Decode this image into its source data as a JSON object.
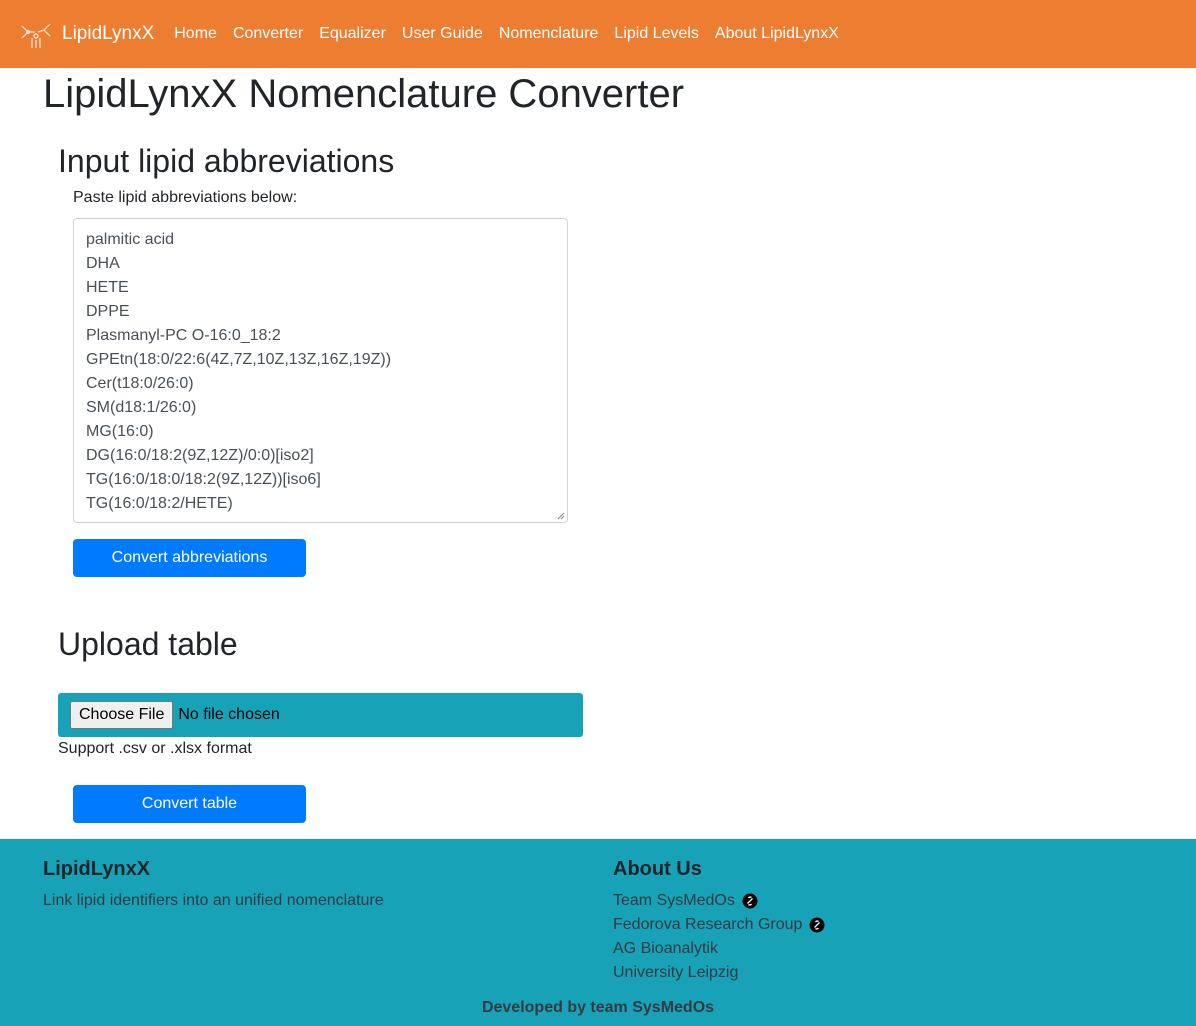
{
  "colors": {
    "nav_bg": "#ed7d31",
    "primary": "#007bff",
    "teal": "#17a2b8"
  },
  "nav": {
    "brand": "LipidLynxX",
    "brand_icon": "lipid-logo-icon",
    "links": [
      "Home",
      "Converter",
      "Equalizer",
      "User Guide",
      "Nomenclature",
      "Lipid Levels",
      "About LipidLynxX"
    ]
  },
  "page": {
    "title": "LipidLynxX Nomenclature Converter"
  },
  "input_section": {
    "title": "Input lipid abbreviations",
    "hint": "Paste lipid abbreviations below:",
    "lines": [
      "palmitic acid",
      "DHA",
      "HETE",
      "DPPE",
      "Plasmanyl-PC O-16:0_18:2",
      "GPEtn(18:0/22:6(4Z,7Z,10Z,13Z,16Z,19Z))",
      "Cer(t18:0/26:0)",
      "SM(d18:1/26:0)",
      "MG(16:0)",
      "DG(16:0/18:2(9Z,12Z)/0:0)[iso2]",
      "TG(16:0/18:0/18:2(9Z,12Z))[iso6]",
      "TG(16:0/18:2/HETE)"
    ],
    "button": "Convert abbreviations"
  },
  "upload_section": {
    "title": "Upload table",
    "choose_file": "Choose File",
    "file_status": "No file chosen",
    "support_text": "Support .csv or .xlsx format",
    "button": "Convert table"
  },
  "footer": {
    "left_heading": "LipidLynxX",
    "left_text": "Link lipid identifiers into an unified nomenclature",
    "right_heading": "About Us",
    "links": [
      {
        "label": "Team SysMedOs",
        "icon": "external-link-icon"
      },
      {
        "label": "Fedorova Research Group",
        "icon": "external-link-icon"
      },
      {
        "label": "AG Bioanalytik",
        "icon": ""
      },
      {
        "label": "University Leipzig",
        "icon": ""
      }
    ],
    "credit": "Developed by team SysMedOs"
  }
}
